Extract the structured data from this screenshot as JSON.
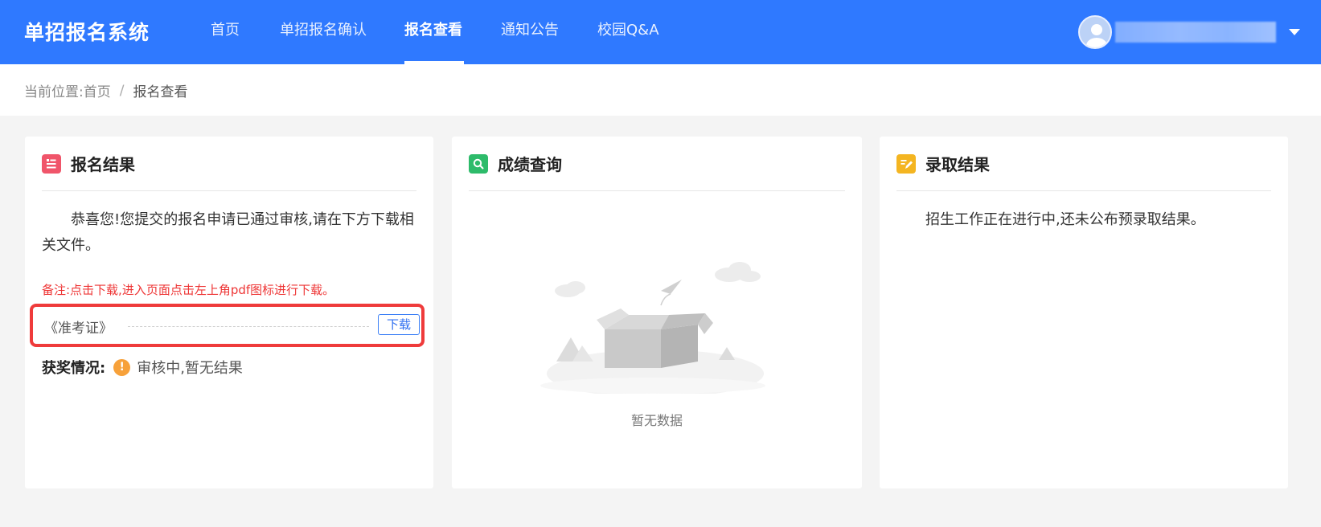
{
  "header": {
    "brand": "单招报名系统",
    "nav": [
      {
        "label": "首页",
        "active": false
      },
      {
        "label": "单招报名确认",
        "active": false
      },
      {
        "label": "报名查看",
        "active": true
      },
      {
        "label": "通知公告",
        "active": false
      },
      {
        "label": "校园Q&A",
        "active": false
      }
    ]
  },
  "breadcrumb": {
    "prefix": "当前位置:",
    "home": "首页",
    "separator": "/",
    "current": "报名查看"
  },
  "cards": {
    "result": {
      "title": "报名结果",
      "icon": "document-list-icon",
      "icon_color": "#f0556a",
      "message": "恭喜您!您提交的报名申请已通过审核,请在下方下载相关文件。",
      "note": "备注:点击下载,进入页面点击左上角pdf图标进行下载。",
      "file": {
        "name": "《准考证》",
        "button": "下载"
      },
      "award": {
        "label": "获奖情况:",
        "status": "审核中,暂无结果",
        "icon": "warning-icon"
      }
    },
    "scores": {
      "title": "成绩查询",
      "icon": "search-icon",
      "icon_color": "#2dbb6a",
      "empty_text": "暂无数据"
    },
    "admission": {
      "title": "录取结果",
      "icon": "edit-icon",
      "icon_color": "#f4b521",
      "message": "招生工作正在进行中,还未公布预录取结果。"
    }
  },
  "colors": {
    "header_bg": "#2f79ff",
    "highlight_border": "#ef3b3b",
    "note_text": "#ee3535",
    "warning": "#f7a13a"
  }
}
